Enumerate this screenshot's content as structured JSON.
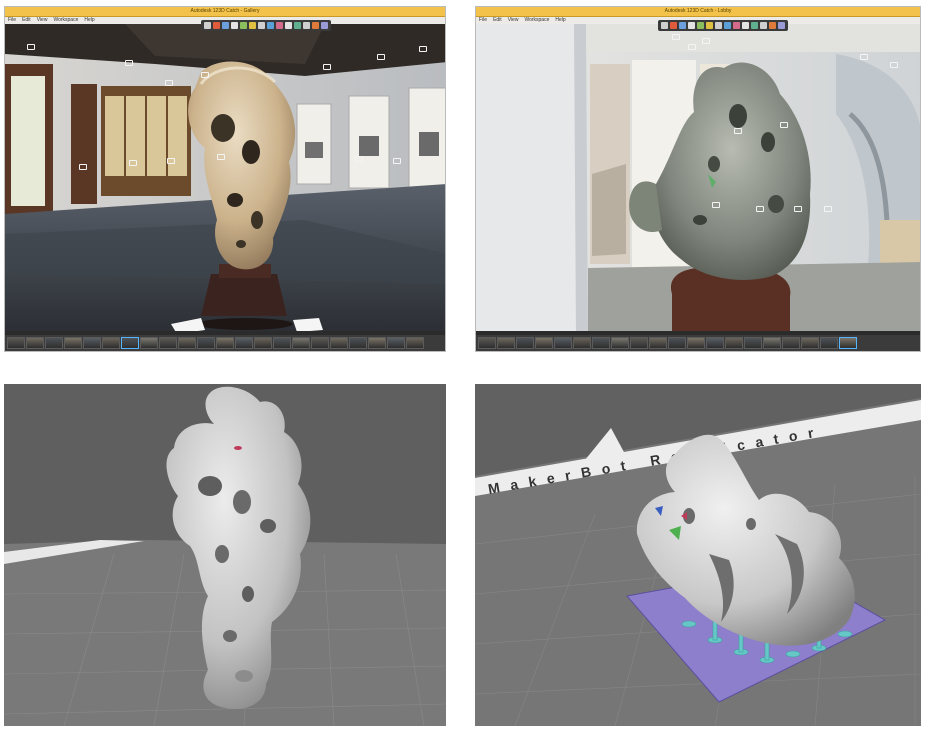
{
  "panels": [
    {
      "id": "p1",
      "window_title": "Autodesk 123D Catch - Gallery",
      "menu": [
        "File",
        "Edit",
        "View",
        "Workspace",
        "Help"
      ],
      "toolbar_icon_count": 14,
      "thumbnail_count": 22,
      "selected_thumbnail": 6,
      "accent": "#f2c24a"
    },
    {
      "id": "p2",
      "window_title": "Autodesk 123D Catch - Lobby",
      "menu": [
        "File",
        "Edit",
        "View",
        "Workspace",
        "Help"
      ],
      "toolbar_icon_count": 14,
      "thumbnail_count": 20,
      "selected_thumbnail": 19,
      "accent": "#f2c24a"
    },
    {
      "id": "p3",
      "view": "3d-mesh-viewport",
      "mesh_color": "#c9c9c9"
    },
    {
      "id": "p4",
      "view": "print-preparation",
      "bed_label": "MakerBot Replicator",
      "build_plate_color": "#8d7fcb",
      "support_color": "#66c7c7"
    }
  ]
}
